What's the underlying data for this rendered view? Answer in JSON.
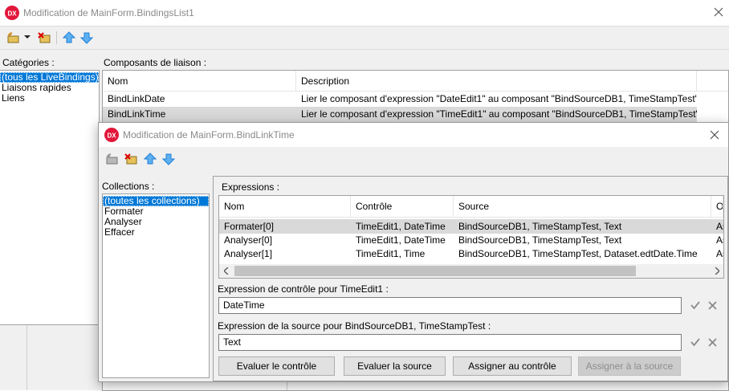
{
  "bg_window": {
    "title": "Modification de MainForm.BindingsList1",
    "app_logo": "DX",
    "categories_label": "Catégories :",
    "categories": [
      "(tous les LiveBindings)",
      "Liaisons rapides",
      "Liens"
    ],
    "components_label": "Composants de liaison :",
    "grid": {
      "headers": [
        "Nom",
        "Description"
      ],
      "rows": [
        {
          "name": "BindLinkDate",
          "description": "Lier le composant d'expression \"DateEdit1\" au composant \"BindSourceDB1, TimeStampTest\""
        },
        {
          "name": "BindLinkTime",
          "description": "Lier le composant d'expression \"TimeEdit1\" au composant \"BindSourceDB1, TimeStampTest\""
        }
      ]
    },
    "icons": [
      "new-item-icon",
      "dropdown-arrow-icon",
      "delete-icon",
      "move-up-icon",
      "move-down-icon",
      "close-icon"
    ]
  },
  "dialog": {
    "title": "Modification de MainForm.BindLinkTime",
    "app_logo": "DX",
    "collections_label": "Collections :",
    "collections": [
      "(toutes les collections)",
      "Formater",
      "Analyser",
      "Effacer"
    ],
    "expressions_label": "Expressions :",
    "grid": {
      "headers": [
        "Nom",
        "Contrôle",
        "Source",
        "O"
      ],
      "rows": [
        {
          "nom": "Formater[0]",
          "controle": "TimeEdit1, DateTime",
          "source": "BindSourceDB1, TimeStampTest, Text",
          "o": "As"
        },
        {
          "nom": "Analyser[0]",
          "controle": "TimeEdit1, DateTime",
          "source": "BindSourceDB1, TimeStampTest, Text",
          "o": "As"
        },
        {
          "nom": "Analyser[1]",
          "controle": "TimeEdit1, Time",
          "source": "BindSourceDB1, TimeStampTest, Dataset.edtDate.Time",
          "o": "As"
        }
      ]
    },
    "control_expr_label": "Expression de contrôle pour TimeEdit1 :",
    "control_expr_value": "DateTime",
    "source_expr_label": "Expression de la source pour BindSourceDB1, TimeStampTest :",
    "source_expr_value": "Text",
    "buttons": {
      "eval_control": "Evaluer le contrôle",
      "eval_source": "Evaluer la source",
      "assign_control": "Assigner au contrôle",
      "assign_source": "Assigner à la source"
    },
    "colors": {
      "accent": "#0078d7",
      "logo_red": "#e2173a",
      "toolbar_blue": "#1e7fd8"
    }
  }
}
